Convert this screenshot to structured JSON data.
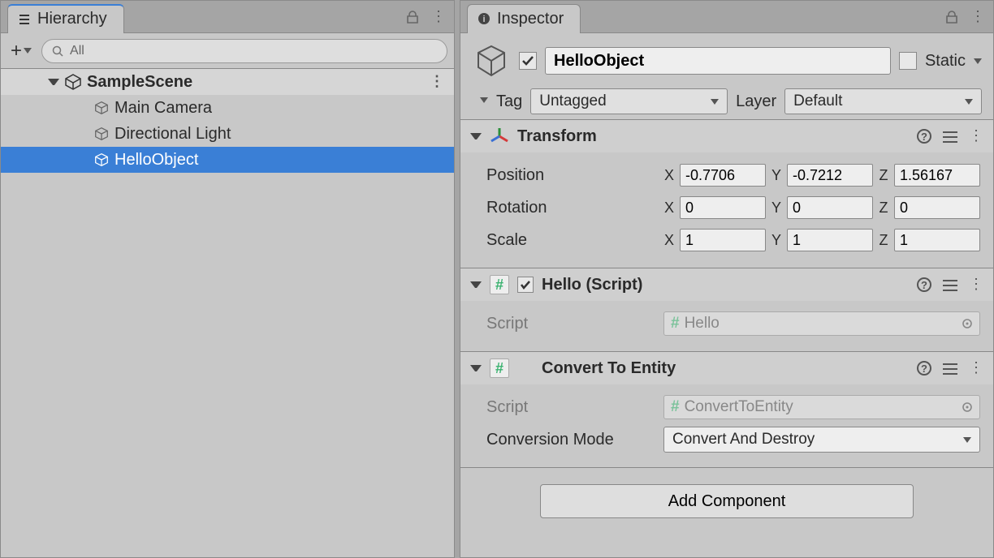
{
  "hierarchy": {
    "title": "Hierarchy",
    "search_placeholder": "All",
    "scene": "SampleScene",
    "items": [
      {
        "label": "Main Camera"
      },
      {
        "label": "Directional Light"
      },
      {
        "label": "HelloObject",
        "selected": true
      }
    ]
  },
  "inspector": {
    "title": "Inspector",
    "object_name": "HelloObject",
    "active": true,
    "static_label": "Static",
    "is_static": false,
    "tag_label": "Tag",
    "tag_value": "Untagged",
    "layer_label": "Layer",
    "layer_value": "Default",
    "transform": {
      "title": "Transform",
      "position_label": "Position",
      "position": {
        "x": "-0.7706",
        "y": "-0.7212",
        "z": "1.56167"
      },
      "rotation_label": "Rotation",
      "rotation": {
        "x": "0",
        "y": "0",
        "z": "0"
      },
      "scale_label": "Scale",
      "scale": {
        "x": "1",
        "y": "1",
        "z": "1"
      }
    },
    "hello": {
      "title": "Hello (Script)",
      "enabled": true,
      "script_label": "Script",
      "script_name": "Hello"
    },
    "convert": {
      "title": "Convert To Entity",
      "script_label": "Script",
      "script_name": "ConvertToEntity",
      "mode_label": "Conversion Mode",
      "mode_value": "Convert And Destroy"
    },
    "add_component_label": "Add Component"
  }
}
